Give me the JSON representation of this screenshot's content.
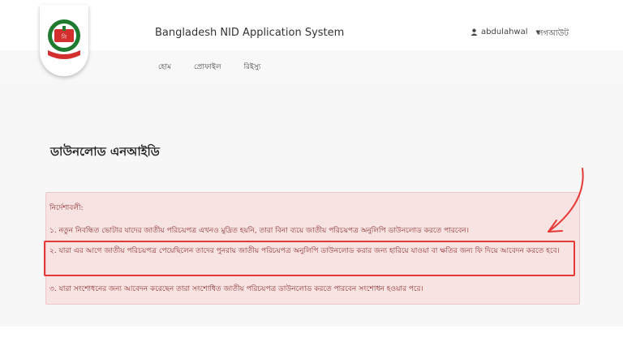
{
  "header": {
    "app_title": "Bangladesh NID Application System",
    "user_icon": "user-icon",
    "username": "abdulahwal",
    "logout_label": "লগআউট"
  },
  "nav": {
    "items": [
      "হোম",
      "প্রোফাইল",
      "রিইস্যু"
    ]
  },
  "main": {
    "page_title": "ডাউনলোড এনআইডি",
    "instructions": {
      "heading": "নির্দেশাবলী:",
      "items": [
        "১. নতুন নিবন্ধিত ভোটার যাদের জাতীয় পরিচয়পত্র এখনও মুদ্রিত হয়নি, তারা বিনা ব্যয়ে জাতীয় পরিচয়পত্র অনুলিপি ডাউনলোড করতে পারবেন।",
        "২. যারা এর আগে জাতীয় পরিচয়পত্র পেয়েছিলেন তাদের পুনরায় জাতীয় পরিচয়পত্র অনুলিপি ডাউনলোড করার জন্য হারিয়ে যাওয়া বা ক্ষতির জন্য ফি দিয়ে আবেদন করতে হবে।",
        "৩. যারা সংশোধনের জন্য আবেদন করেছেন তারা সংশোধিত জাতীয় পরিচয়পত্র ডাউনলোড করতে পারবেন সংশোধন হওয়ার পরে।"
      ]
    }
  },
  "colors": {
    "alert_bg": "#f8e3e3",
    "alert_text": "#8b2b2b",
    "highlight": "#e53935",
    "logo_green": "#1e7a2e",
    "logo_red": "#d32f2f"
  }
}
